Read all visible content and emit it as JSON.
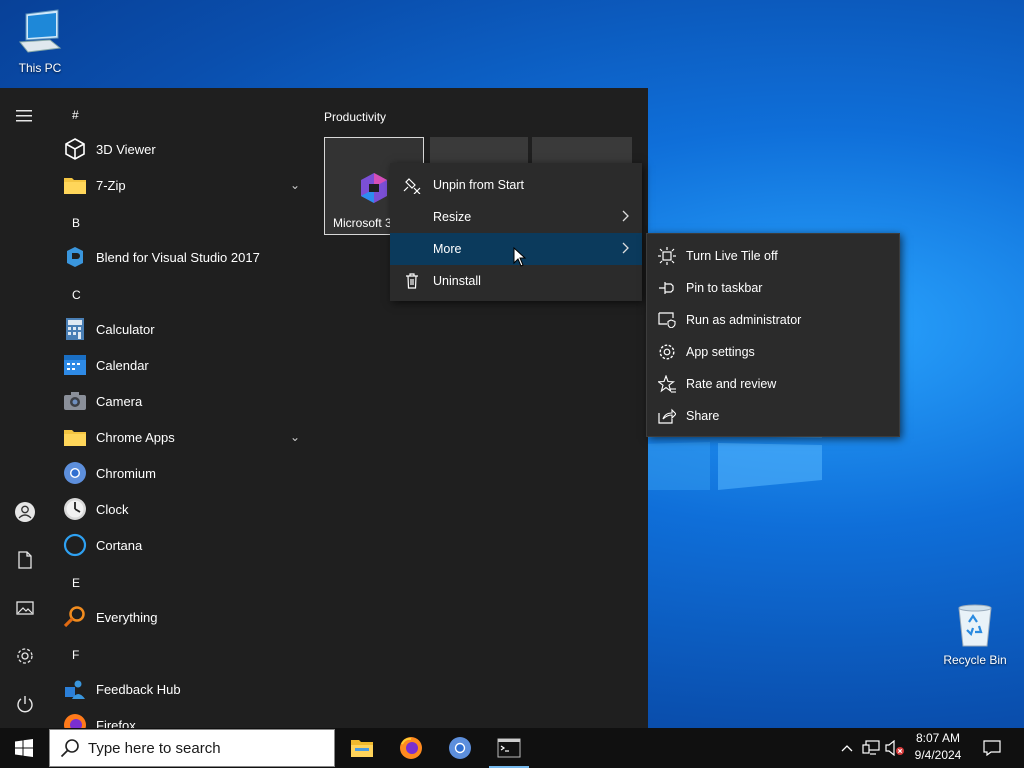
{
  "desktop": {
    "icons": [
      {
        "label": "This PC",
        "icon": "computer-icon"
      },
      {
        "label": "Recycle Bin",
        "icon": "recycle-bin-icon"
      }
    ]
  },
  "start_menu": {
    "rail": [
      {
        "name": "hamburger-menu-icon"
      },
      {
        "name": "user-account-icon"
      },
      {
        "name": "documents-icon"
      },
      {
        "name": "pictures-icon"
      },
      {
        "name": "settings-icon"
      },
      {
        "name": "power-icon"
      }
    ],
    "sections": {
      "hash": "#",
      "b": "B",
      "c": "C",
      "e": "E",
      "f": "F"
    },
    "apps": {
      "viewer3d": "3D Viewer",
      "zip": "7-Zip",
      "blend": "Blend for Visual Studio 2017",
      "calculator": "Calculator",
      "calendar": "Calendar",
      "camera": "Camera",
      "chrome_apps": "Chrome Apps",
      "chromium": "Chromium",
      "clock": "Clock",
      "cortana": "Cortana",
      "everything": "Everything",
      "feedback": "Feedback Hub",
      "firefox": "Firefox"
    },
    "tiles": {
      "group_label": "Productivity",
      "main_tile_label": "Microsoft 3"
    }
  },
  "context_menu": {
    "unpin": "Unpin from Start",
    "resize": "Resize",
    "more": "More",
    "uninstall": "Uninstall"
  },
  "more_submenu": {
    "live_tile": "Turn Live Tile off",
    "pin_taskbar": "Pin to taskbar",
    "run_admin": "Run as administrator",
    "app_settings": "App settings",
    "rate": "Rate and review",
    "share": "Share"
  },
  "taskbar": {
    "search_placeholder": "Type here to search",
    "apps": [
      "file-explorer-icon",
      "firefox-icon",
      "chromium-icon",
      "terminal-icon"
    ],
    "time": "8:07 AM",
    "date": "9/4/2024"
  },
  "colors": {
    "menu_bg": "#1f1f1f",
    "context_bg": "#2b2b2b",
    "highlight": "#0b3a5c",
    "taskbar_bg": "#101010"
  }
}
